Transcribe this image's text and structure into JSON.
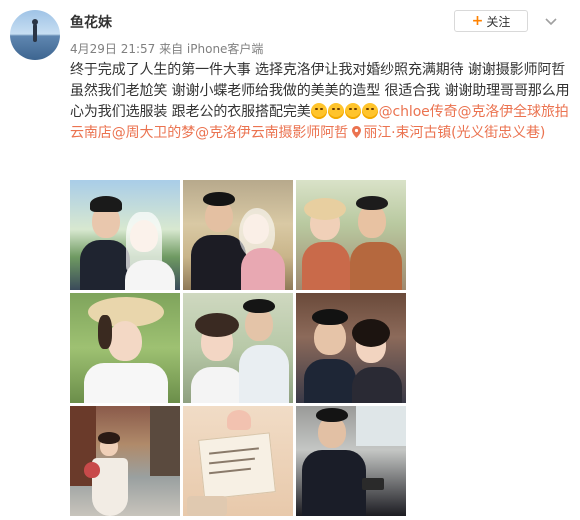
{
  "user": {
    "name": "鱼花妹",
    "meta": "4月29日 21:57 来自 iPhone客户端"
  },
  "follow": {
    "label": "关注"
  },
  "post": {
    "text_1": "终于完成了人生的第一件大事 选择克洛伊让我对婚纱照充满期待 谢谢摄影师阿哲 虽然我们老尬笑 谢谢小蝶老师给我做的美美的造型 很适合我 谢谢助理哥哥那么用心为我们选服装 跟老公的衣服搭配完美",
    "mention_1": "@chloe传奇",
    "mention_2": "@克洛伊全球旅拍云南店",
    "mention_3": "@周大卫的梦",
    "mention_4": "@克洛伊云南摄影师阿哲",
    "location": "丽江·束河古镇(光义街忠义巷)"
  },
  "photos": [
    {
      "name": "couple-photo-1"
    },
    {
      "name": "couple-photo-2"
    },
    {
      "name": "couple-photo-3"
    },
    {
      "name": "bride-photo-4"
    },
    {
      "name": "couple-photo-5"
    },
    {
      "name": "couple-photo-6"
    },
    {
      "name": "street-photo-7"
    },
    {
      "name": "card-photo-8"
    },
    {
      "name": "car-photo-9"
    }
  ],
  "colors": {
    "link": "#eb7350",
    "accent": "#ff8200",
    "text": "#333333",
    "meta": "#808080"
  }
}
